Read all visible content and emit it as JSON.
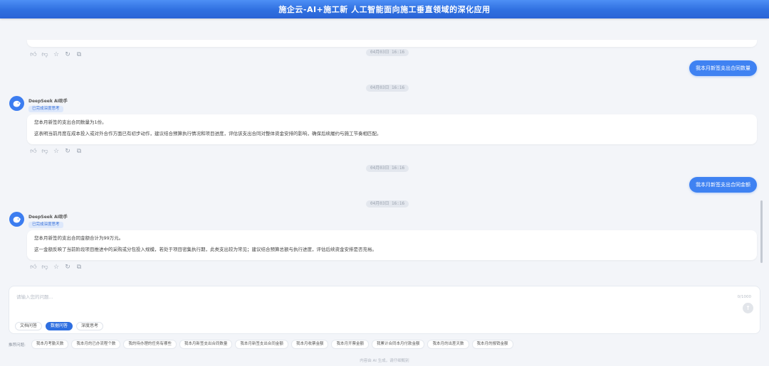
{
  "header": {
    "title": "施企云-AI+施工新 人工智能面向施工垂直领域的深化应用"
  },
  "assistant": {
    "name": "DeepSeek AI助手",
    "think_badge": "已完成深度思考"
  },
  "messages": [
    {
      "time": "04月03日 16:16",
      "user": "我本月新签支出合同数量",
      "reply": [
        "您本月新签的支出合同数量为1份。",
        "这表明当前月度在成本投入或对外合作方面已有初步动作，建议结合预算执行情况和项目进度，评估该支出合同对整体资金安排的影响，确保后续履约与施工节奏相匹配。"
      ]
    },
    {
      "time": "04月03日 16:16",
      "user": "我本月新签支出合同金额",
      "reply": [
        "您本月新签的支出合同金额合计为99万元。",
        "这一金额反映了当前阶段项目推进中的采购或分包投入规模，若处于项目密集执行期，此类支出较为常见；建议结合预算总额与执行进度，评估后续资金安排是否充裕。"
      ]
    }
  ],
  "input": {
    "placeholder": "请输入您的问题...",
    "counter": "0/1000",
    "send_icon": "arrow-up-icon"
  },
  "modes": [
    {
      "label": "文档问答",
      "active": false
    },
    {
      "label": "数据问答",
      "active": true
    },
    {
      "label": "深度思考",
      "active": false
    }
  ],
  "recommend": {
    "label": "推荐问题:",
    "chips": [
      "我本月考勤天数",
      "我本月的已办流程个数",
      "我的待办理的任务有哪些",
      "我本月新签支出合同数量",
      "我本月新签支出合同金额",
      "我本月收票金额",
      "我本月开票金额",
      "我累计合同本月付款金额",
      "我本月的出差天数",
      "我本月的报销金额"
    ]
  },
  "footer": {
    "text": "内容由 AI 生成，请仔细甄别"
  },
  "colors": {
    "brand": "#2f6fe0",
    "user_bubble": "#3f82f2"
  }
}
